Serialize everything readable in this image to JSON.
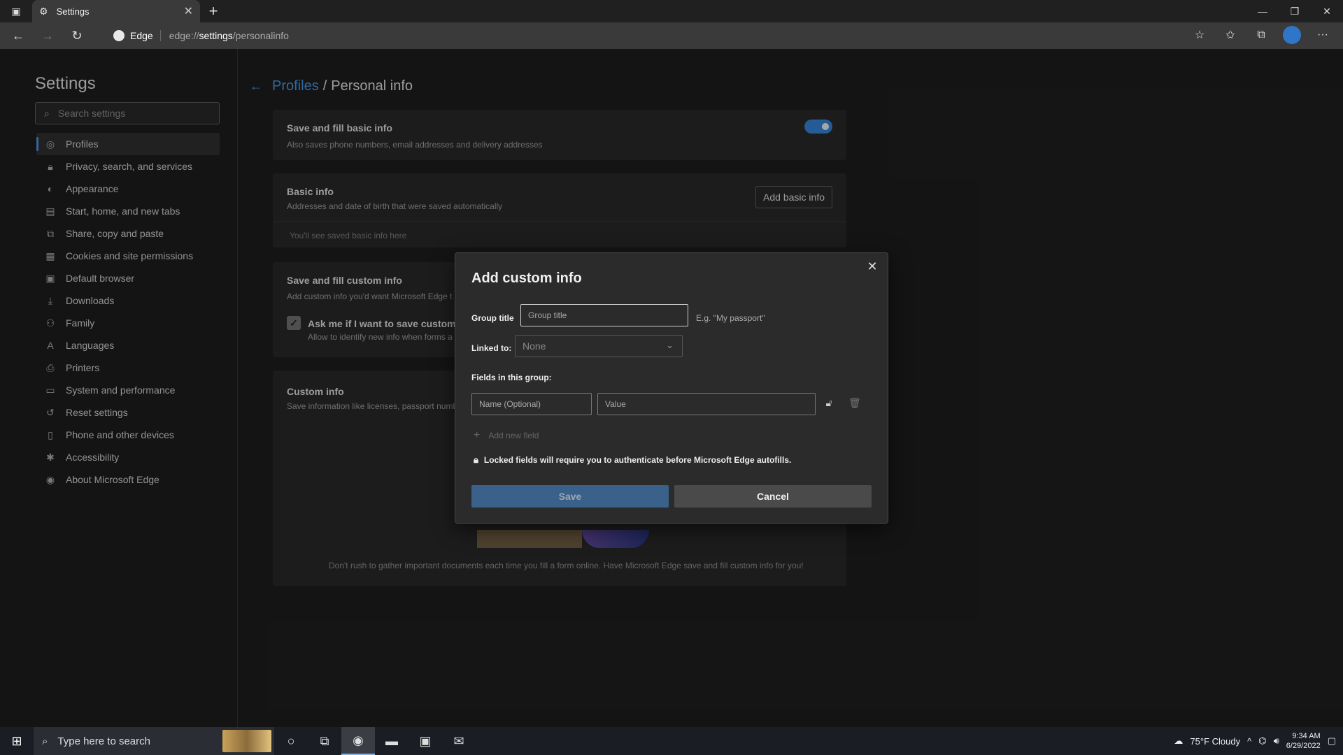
{
  "browser": {
    "tab_title": "Settings",
    "address_chip": "Edge",
    "url_prefix": "edge://",
    "url_bold": "settings",
    "url_rest": "/personalinfo"
  },
  "sidebar": {
    "title": "Settings",
    "search_placeholder": "Search settings",
    "items": [
      {
        "label": "Profiles",
        "icon": "profile-icon"
      },
      {
        "label": "Privacy, search, and services",
        "icon": "lock-icon"
      },
      {
        "label": "Appearance",
        "icon": "appearance-icon"
      },
      {
        "label": "Start, home, and new tabs",
        "icon": "home-tabs-icon"
      },
      {
        "label": "Share, copy and paste",
        "icon": "share-icon"
      },
      {
        "label": "Cookies and site permissions",
        "icon": "cookies-icon"
      },
      {
        "label": "Default browser",
        "icon": "default-browser-icon"
      },
      {
        "label": "Downloads",
        "icon": "download-icon"
      },
      {
        "label": "Family",
        "icon": "family-icon"
      },
      {
        "label": "Languages",
        "icon": "languages-icon"
      },
      {
        "label": "Printers",
        "icon": "printer-icon"
      },
      {
        "label": "System and performance",
        "icon": "system-icon"
      },
      {
        "label": "Reset settings",
        "icon": "reset-icon"
      },
      {
        "label": "Phone and other devices",
        "icon": "phone-icon"
      },
      {
        "label": "Accessibility",
        "icon": "accessibility-icon"
      },
      {
        "label": "About Microsoft Edge",
        "icon": "edge-icon"
      }
    ]
  },
  "main": {
    "breadcrumb_link": "Profiles",
    "breadcrumb_sep": "/",
    "breadcrumb_current": "Personal info",
    "card_basic_fill": {
      "title": "Save and fill basic info",
      "sub": "Also saves phone numbers, email addresses and delivery addresses",
      "toggle_on": true
    },
    "card_basic_info": {
      "title": "Basic info",
      "sub": "Addresses and date of birth that were saved automatically",
      "button": "Add basic info",
      "empty": "You'll see saved basic info here"
    },
    "card_custom_fill": {
      "title": "Save and fill custom info",
      "sub": "Add custom info you'd want Microsoft Edge t",
      "check_label": "Ask me if I want to save custom i",
      "check_sub": "Allow to identify new info when forms a"
    },
    "card_custom_info": {
      "title": "Custom info",
      "sub": "Save information like licenses, passport numb",
      "footer": "Don't rush to gather important documents each time you fill a form online. Have Microsoft Edge save and fill custom info for you!"
    }
  },
  "dialog": {
    "title": "Add custom info",
    "group_title_label": "Group title",
    "group_title_placeholder": "Group title",
    "group_title_hint": "E.g. \"My passport\"",
    "linked_label": "Linked to:",
    "linked_value": "None",
    "fields_label": "Fields in this group:",
    "name_placeholder": "Name (Optional)",
    "value_placeholder": "Value",
    "add_field": "Add new field",
    "locked_note": "Locked fields will require you to authenticate before Microsoft Edge autofills.",
    "save": "Save",
    "cancel": "Cancel"
  },
  "taskbar": {
    "search_placeholder": "Type here to search",
    "weather": "75°F  Cloudy",
    "time": "9:34 AM",
    "date": "6/29/2022"
  }
}
